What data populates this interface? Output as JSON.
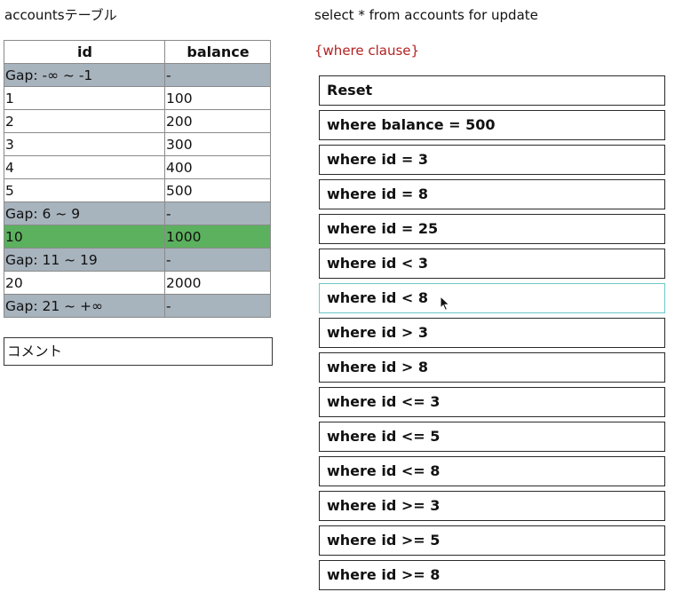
{
  "left_title": "accountsテーブル",
  "table": {
    "headers": [
      "id",
      "balance"
    ],
    "rows": [
      {
        "kind": "gap",
        "id": "Gap: -∞ ~ -1",
        "balance": "-"
      },
      {
        "kind": "normal",
        "id": "1",
        "balance": "100"
      },
      {
        "kind": "normal",
        "id": "2",
        "balance": "200"
      },
      {
        "kind": "normal",
        "id": "3",
        "balance": "300"
      },
      {
        "kind": "normal",
        "id": "4",
        "balance": "400"
      },
      {
        "kind": "normal",
        "id": "5",
        "balance": "500"
      },
      {
        "kind": "gap",
        "id": "Gap: 6 ~ 9",
        "balance": "-"
      },
      {
        "kind": "locked",
        "id": "10",
        "balance": "1000"
      },
      {
        "kind": "gap",
        "id": "Gap: 11 ~ 19",
        "balance": "-"
      },
      {
        "kind": "normal",
        "id": "20",
        "balance": "2000"
      },
      {
        "kind": "gap",
        "id": "Gap: 21 ~ +∞",
        "balance": "-"
      }
    ]
  },
  "comment": "コメント",
  "sql_title": "select * from accounts for update",
  "where_clause": "{where clause}",
  "buttons": [
    "Reset",
    "where balance = 500",
    "where id = 3",
    "where id = 8",
    "where id = 25",
    "where id < 3",
    "where id < 8",
    "where id > 3",
    "where id > 8",
    "where id <= 3",
    "where id <= 5",
    "where id <= 8",
    "where id >= 3",
    "where id >= 5",
    "where id >= 8"
  ],
  "hovered_button_index": 6,
  "colors": {
    "gap_row": "#a7b3bd",
    "locked_row": "#5cb15e",
    "where_clause_text": "#b22222",
    "hover_border": "#6ec7c7"
  }
}
